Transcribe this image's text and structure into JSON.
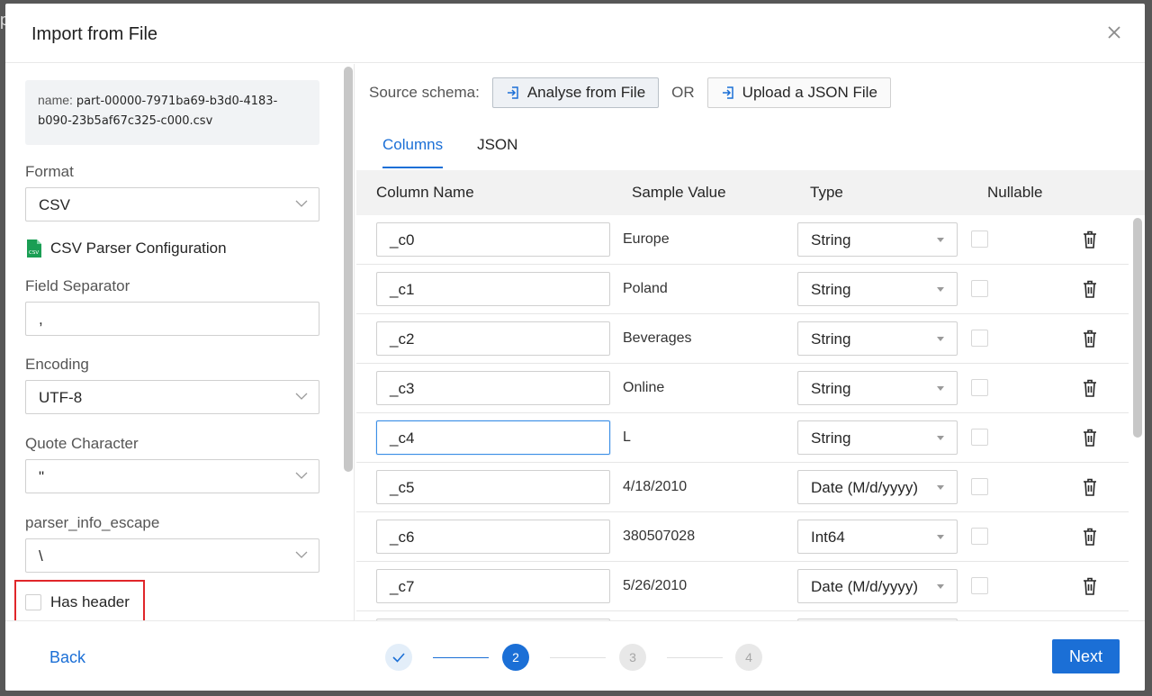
{
  "modal": {
    "title": "Import from File"
  },
  "left": {
    "name_label": "name: ",
    "file_name_line1": "part-00000-7971ba69-b3d0-4183-",
    "file_name_line2": "b090-23b5af67c325-c000.csv",
    "format_label": "Format",
    "format_value": "CSV",
    "parser_title": "CSV Parser Configuration",
    "field_separator_label": "Field Separator",
    "field_separator_value": ",",
    "encoding_label": "Encoding",
    "encoding_value": "UTF-8",
    "quote_label": "Quote Character",
    "quote_value": "\"",
    "escape_label": "parser_info_escape",
    "escape_value": "\\",
    "has_header_label": "Has header",
    "has_header_checked": false
  },
  "right": {
    "source_schema_label": "Source schema:",
    "analyse_button": "Analyse from File",
    "or_text": "OR",
    "upload_button": "Upload a JSON File",
    "tabs": [
      {
        "label": "Columns",
        "active": true
      },
      {
        "label": "JSON",
        "active": false
      }
    ],
    "table": {
      "headers": {
        "column_name": "Column Name",
        "sample_value": "Sample Value",
        "type": "Type",
        "nullable": "Nullable"
      },
      "rows": [
        {
          "name": "_c0",
          "sample": "Europe",
          "type": "String",
          "nullable": false
        },
        {
          "name": "_c1",
          "sample": "Poland",
          "type": "String",
          "nullable": false
        },
        {
          "name": "_c2",
          "sample": "Beverages",
          "type": "String",
          "nullable": false
        },
        {
          "name": "_c3",
          "sample": "Online",
          "type": "String",
          "nullable": false
        },
        {
          "name": "_c4",
          "sample": "L",
          "type": "String",
          "nullable": false,
          "focused": true
        },
        {
          "name": "_c5",
          "sample": "4/18/2010",
          "type": "Date (M/d/yyyy)",
          "nullable": false
        },
        {
          "name": "_c6",
          "sample": "380507028",
          "type": "Int64",
          "nullable": false
        },
        {
          "name": "_c7",
          "sample": "5/26/2010",
          "type": "Date (M/d/yyyy)",
          "nullable": false
        }
      ]
    }
  },
  "footer": {
    "back_label": "Back",
    "next_label": "Next",
    "steps": [
      {
        "label": "✓",
        "state": "done"
      },
      {
        "label": "2",
        "state": "current"
      },
      {
        "label": "3",
        "state": "todo"
      },
      {
        "label": "4",
        "state": "todo"
      }
    ]
  },
  "colors": {
    "accent": "#1b6fd6",
    "highlight": "#e0262a",
    "csv_icon": "#1a9e54"
  },
  "backdrop": {
    "partial_char": "p"
  }
}
